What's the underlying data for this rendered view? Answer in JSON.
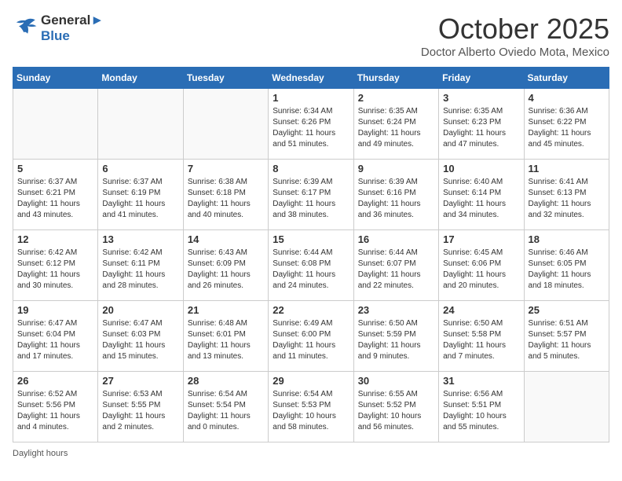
{
  "header": {
    "logo_line1": "General",
    "logo_line2": "Blue",
    "month": "October 2025",
    "location": "Doctor Alberto Oviedo Mota, Mexico"
  },
  "weekdays": [
    "Sunday",
    "Monday",
    "Tuesday",
    "Wednesday",
    "Thursday",
    "Friday",
    "Saturday"
  ],
  "weeks": [
    [
      {
        "day": "",
        "info": ""
      },
      {
        "day": "",
        "info": ""
      },
      {
        "day": "",
        "info": ""
      },
      {
        "day": "1",
        "info": "Sunrise: 6:34 AM\nSunset: 6:26 PM\nDaylight: 11 hours\nand 51 minutes."
      },
      {
        "day": "2",
        "info": "Sunrise: 6:35 AM\nSunset: 6:24 PM\nDaylight: 11 hours\nand 49 minutes."
      },
      {
        "day": "3",
        "info": "Sunrise: 6:35 AM\nSunset: 6:23 PM\nDaylight: 11 hours\nand 47 minutes."
      },
      {
        "day": "4",
        "info": "Sunrise: 6:36 AM\nSunset: 6:22 PM\nDaylight: 11 hours\nand 45 minutes."
      }
    ],
    [
      {
        "day": "5",
        "info": "Sunrise: 6:37 AM\nSunset: 6:21 PM\nDaylight: 11 hours\nand 43 minutes."
      },
      {
        "day": "6",
        "info": "Sunrise: 6:37 AM\nSunset: 6:19 PM\nDaylight: 11 hours\nand 41 minutes."
      },
      {
        "day": "7",
        "info": "Sunrise: 6:38 AM\nSunset: 6:18 PM\nDaylight: 11 hours\nand 40 minutes."
      },
      {
        "day": "8",
        "info": "Sunrise: 6:39 AM\nSunset: 6:17 PM\nDaylight: 11 hours\nand 38 minutes."
      },
      {
        "day": "9",
        "info": "Sunrise: 6:39 AM\nSunset: 6:16 PM\nDaylight: 11 hours\nand 36 minutes."
      },
      {
        "day": "10",
        "info": "Sunrise: 6:40 AM\nSunset: 6:14 PM\nDaylight: 11 hours\nand 34 minutes."
      },
      {
        "day": "11",
        "info": "Sunrise: 6:41 AM\nSunset: 6:13 PM\nDaylight: 11 hours\nand 32 minutes."
      }
    ],
    [
      {
        "day": "12",
        "info": "Sunrise: 6:42 AM\nSunset: 6:12 PM\nDaylight: 11 hours\nand 30 minutes."
      },
      {
        "day": "13",
        "info": "Sunrise: 6:42 AM\nSunset: 6:11 PM\nDaylight: 11 hours\nand 28 minutes."
      },
      {
        "day": "14",
        "info": "Sunrise: 6:43 AM\nSunset: 6:09 PM\nDaylight: 11 hours\nand 26 minutes."
      },
      {
        "day": "15",
        "info": "Sunrise: 6:44 AM\nSunset: 6:08 PM\nDaylight: 11 hours\nand 24 minutes."
      },
      {
        "day": "16",
        "info": "Sunrise: 6:44 AM\nSunset: 6:07 PM\nDaylight: 11 hours\nand 22 minutes."
      },
      {
        "day": "17",
        "info": "Sunrise: 6:45 AM\nSunset: 6:06 PM\nDaylight: 11 hours\nand 20 minutes."
      },
      {
        "day": "18",
        "info": "Sunrise: 6:46 AM\nSunset: 6:05 PM\nDaylight: 11 hours\nand 18 minutes."
      }
    ],
    [
      {
        "day": "19",
        "info": "Sunrise: 6:47 AM\nSunset: 6:04 PM\nDaylight: 11 hours\nand 17 minutes."
      },
      {
        "day": "20",
        "info": "Sunrise: 6:47 AM\nSunset: 6:03 PM\nDaylight: 11 hours\nand 15 minutes."
      },
      {
        "day": "21",
        "info": "Sunrise: 6:48 AM\nSunset: 6:01 PM\nDaylight: 11 hours\nand 13 minutes."
      },
      {
        "day": "22",
        "info": "Sunrise: 6:49 AM\nSunset: 6:00 PM\nDaylight: 11 hours\nand 11 minutes."
      },
      {
        "day": "23",
        "info": "Sunrise: 6:50 AM\nSunset: 5:59 PM\nDaylight: 11 hours\nand 9 minutes."
      },
      {
        "day": "24",
        "info": "Sunrise: 6:50 AM\nSunset: 5:58 PM\nDaylight: 11 hours\nand 7 minutes."
      },
      {
        "day": "25",
        "info": "Sunrise: 6:51 AM\nSunset: 5:57 PM\nDaylight: 11 hours\nand 5 minutes."
      }
    ],
    [
      {
        "day": "26",
        "info": "Sunrise: 6:52 AM\nSunset: 5:56 PM\nDaylight: 11 hours\nand 4 minutes."
      },
      {
        "day": "27",
        "info": "Sunrise: 6:53 AM\nSunset: 5:55 PM\nDaylight: 11 hours\nand 2 minutes."
      },
      {
        "day": "28",
        "info": "Sunrise: 6:54 AM\nSunset: 5:54 PM\nDaylight: 11 hours\nand 0 minutes."
      },
      {
        "day": "29",
        "info": "Sunrise: 6:54 AM\nSunset: 5:53 PM\nDaylight: 10 hours\nand 58 minutes."
      },
      {
        "day": "30",
        "info": "Sunrise: 6:55 AM\nSunset: 5:52 PM\nDaylight: 10 hours\nand 56 minutes."
      },
      {
        "day": "31",
        "info": "Sunrise: 6:56 AM\nSunset: 5:51 PM\nDaylight: 10 hours\nand 55 minutes."
      },
      {
        "day": "",
        "info": ""
      }
    ]
  ],
  "footer": {
    "daylight_label": "Daylight hours"
  }
}
